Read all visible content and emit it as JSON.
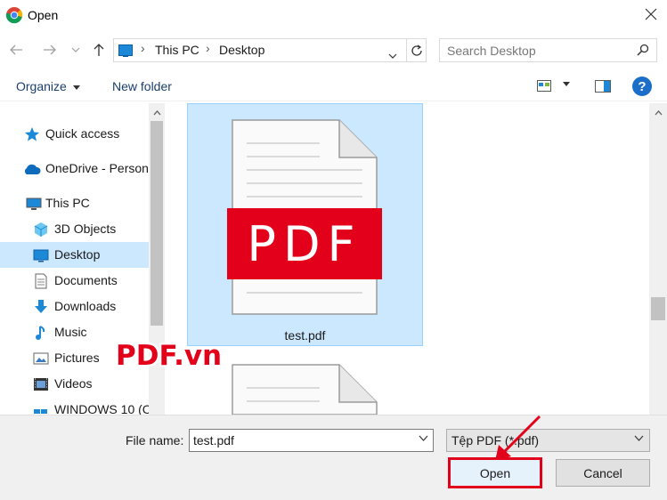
{
  "window": {
    "title": "Open"
  },
  "address_bar": {
    "crumbs": [
      "This PC",
      "Desktop"
    ]
  },
  "search": {
    "placeholder": "Search Desktop"
  },
  "toolbar": {
    "organize": "Organize",
    "new_folder": "New folder",
    "help": "?"
  },
  "sidebar": {
    "items": [
      {
        "label": "Quick access",
        "icon": "star-icon"
      },
      {
        "label": "OneDrive - Person",
        "icon": "cloud-icon"
      },
      {
        "label": "This PC",
        "icon": "computer-icon"
      },
      {
        "label": "3D Objects",
        "icon": "cube-icon"
      },
      {
        "label": "Desktop",
        "icon": "desktop-icon",
        "selected": true
      },
      {
        "label": "Documents",
        "icon": "document-icon"
      },
      {
        "label": "Downloads",
        "icon": "download-icon"
      },
      {
        "label": "Music",
        "icon": "music-icon"
      },
      {
        "label": "Pictures",
        "icon": "pictures-icon"
      },
      {
        "label": "Videos",
        "icon": "video-icon"
      },
      {
        "label": "WINDOWS 10 (C",
        "icon": "windows-drive-icon"
      }
    ]
  },
  "files": [
    {
      "name": "test.pdf",
      "badge": "PDF",
      "selected": true
    }
  ],
  "watermark": "PDF.vn",
  "footer": {
    "file_name_label": "File name:",
    "file_name_value": "test.pdf",
    "file_type": "Tệp PDF (*.pdf)",
    "open_button": "Open",
    "cancel_button": "Cancel"
  },
  "colors": {
    "accent": "#0078d7",
    "selection": "#cce8ff",
    "highlight_red": "#e2001a"
  }
}
